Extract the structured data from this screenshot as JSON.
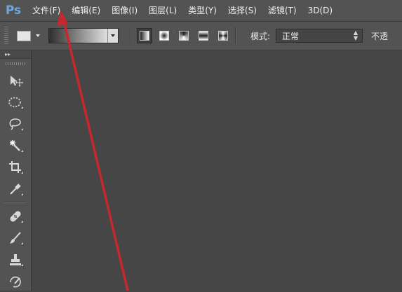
{
  "app": {
    "logo": "Ps"
  },
  "menu": {
    "items": [
      "文件(F)",
      "编辑(E)",
      "图像(I)",
      "图层(L)",
      "类型(Y)",
      "选择(S)",
      "滤镜(T)",
      "3D(D)"
    ]
  },
  "options_bar": {
    "gradient_types": [
      "linear",
      "radial",
      "angle",
      "reflected",
      "diamond"
    ],
    "selected_gradient_type": "linear",
    "mode_label": "模式:",
    "mode_value": "正常",
    "opacity_label_partial": "不透"
  },
  "toolbox": {
    "collapse_glyph": "▸▸",
    "tools": [
      "move-tool-icon",
      "elliptical-marquee-icon",
      "lasso-icon",
      "magic-wand-icon",
      "crop-icon",
      "eyedropper-icon",
      "healing-brush-icon",
      "brush-icon",
      "clone-stamp-icon",
      "history-brush-icon"
    ]
  },
  "annotation": {
    "arrow_color": "#c8282d"
  },
  "colors": {
    "menubar_bg": "#535353",
    "workspace_bg": "#464646",
    "logo_blue": "#6fa6e0"
  }
}
